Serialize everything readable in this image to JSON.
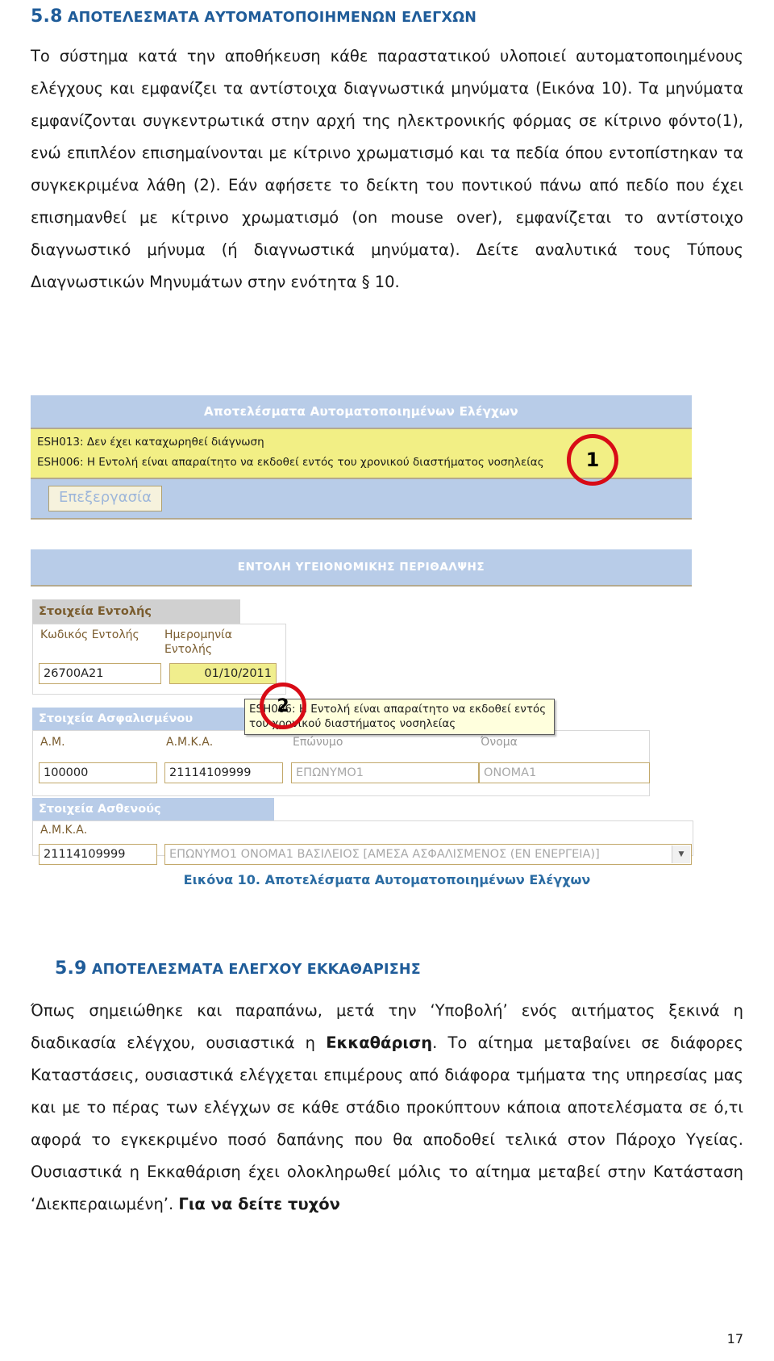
{
  "document": {
    "page_number": "17"
  },
  "sections": [
    {
      "number": "5.8",
      "title": "ΑΠΟΤΕΛΕΣΜΑΤΑ ΑΥΤΟΜΑΤΟΠΟΙΗΜΕΝΩΝ ΕΛΕΓΧΩΝ"
    },
    {
      "number": "5.9",
      "title": "ΑΠΟΤΕΛΕΣΜΑΤΑ ΕΛΕΓΧΟΥ ΕΚΚΑΘΑΡΙΣΗΣ"
    }
  ],
  "paragraphs": {
    "p1_part1": "Το σύστημα κατά την αποθήκευση κάθε παραστατικού υλοποιεί αυτοματοποιημένους ελέγχους και εμφανίζει τα αντίστοιχα διαγνωστικά μηνύματα (Εικόνα 10). Τα μηνύματα εμφανίζονται συγκεντρωτικά στην αρχή της ηλεκτρονικής φόρμας σε κίτρινο φόντο(1), ενώ επιπλέον επισημαίνονται με κίτρινο χρωματισμό και τα πεδία όπου εντοπίστηκαν τα συγκεκριμένα λάθη (2). Εάν αφήσετε το δείκτη του ποντικού πάνω από πεδίο που έχει επισημανθεί με κίτρινο χρωματισμό (on mouse over), εμφανίζεται το αντίστοιχο διαγνωστικό μήνυμα (ή διαγνωστικά μηνύματα). Δείτε αναλυτικά τους Τύπους Διαγνωστικών Μηνυμάτων στην ενότητα § 10.",
    "p2_a": "Όπως σημειώθηκε και παραπάνω, μετά την ‘Υποβολή’ ενός αιτήματος ξεκινά η διαδικασία ελέγχου, ουσιαστικά η ",
    "p2_b": "Εκκαθάριση",
    "p2_c": ". Το αίτημα μεταβαίνει σε διάφορες Καταστάσεις, ουσιαστικά ελέγχεται επιμέρους από διάφορα τμήματα της υπηρεσίας μας και με το πέρας των ελέγχων σε κάθε στάδιο προκύπτουν κάποια αποτελέσματα σε ό,τι αφορά το εγκεκριμένο ποσό δαπάνης που θα αποδοθεί τελικά στον Πάροχο Υγείας. Ουσιαστικά η Εκκαθάριση έχει ολοκληρωθεί μόλις το αίτημα μεταβεί στην Κατάσταση ‘Διεκπεραιωμένη’. ",
    "p2_d": "Για να δείτε τυχόν"
  },
  "figure": {
    "caption": "Εικόνα 10. Αποτελέσματα Αυτοματοποιημένων Ελέγχων",
    "results_panel": {
      "title": "Αποτελέσματα Αυτοματοποιημένων Ελέγχων",
      "messages": [
        "ESH013: Δεν έχει καταχωρηθεί διάγνωση",
        "ESH006: Η Εντολή είναι απαραίτητο να εκδοθεί εντός του χρονικού διαστήματος νοσηλείας"
      ],
      "edit_button": "Επεξεργασία"
    },
    "order_panel": {
      "title": "ΕΝΤΟΛΗ ΥΓΕΙΟΝΟΜΙΚΗΣ ΠΕΡΙΘΑΛΨΗΣ"
    },
    "order_details": {
      "group_title": "Στοιχεία Εντολής",
      "code_label": "Κωδικός Εντολής",
      "code_value": "26700A21",
      "date_label": "Ημερομηνία Εντολής",
      "date_value": "01/10/2011"
    },
    "tooltip": {
      "text": "ESH006: Η Εντολή είναι απαραίτητο να εκδοθεί εντός του χρονικού διαστήματος νοσηλείας"
    },
    "insured_details": {
      "group_title": "Στοιχεία Ασφαλισμένου",
      "am_label": "Α.Μ.",
      "am_value": "100000",
      "amka_label": "Α.Μ.Κ.Α.",
      "amka_value": "21114109999",
      "surname_label": "Επώνυμο",
      "surname_value": "ΕΠΩΝΥΜΟ1",
      "name_label": "Όνομα",
      "name_value": "ONOMA1"
    },
    "patient_details": {
      "group_title": "Στοιχεία Ασθενούς",
      "amka_label": "Α.Μ.Κ.Α.",
      "amka_value": "21114109999",
      "select_value": "ΕΠΩΝΥΜΟ1 ΟΝΟΜΑ1 ΒΑΣΙΛΕΙΟΣ [ΑΜΕΣΑ ΑΣΦΑΛΙΣΜΕΝΟΣ (ΕΝ ΕΝΕΡΓΕΙΑ)]",
      "dropdown_arrow": "▼"
    },
    "callouts": [
      {
        "label": "1"
      },
      {
        "label": "2"
      }
    ]
  },
  "colors": {
    "heading_blue": "#1f5c99",
    "panel_blue": "#b8cce8",
    "warning_yellow": "#f2ef85",
    "callout_red": "#d80b16",
    "caption_blue": "#2b6ca3"
  }
}
